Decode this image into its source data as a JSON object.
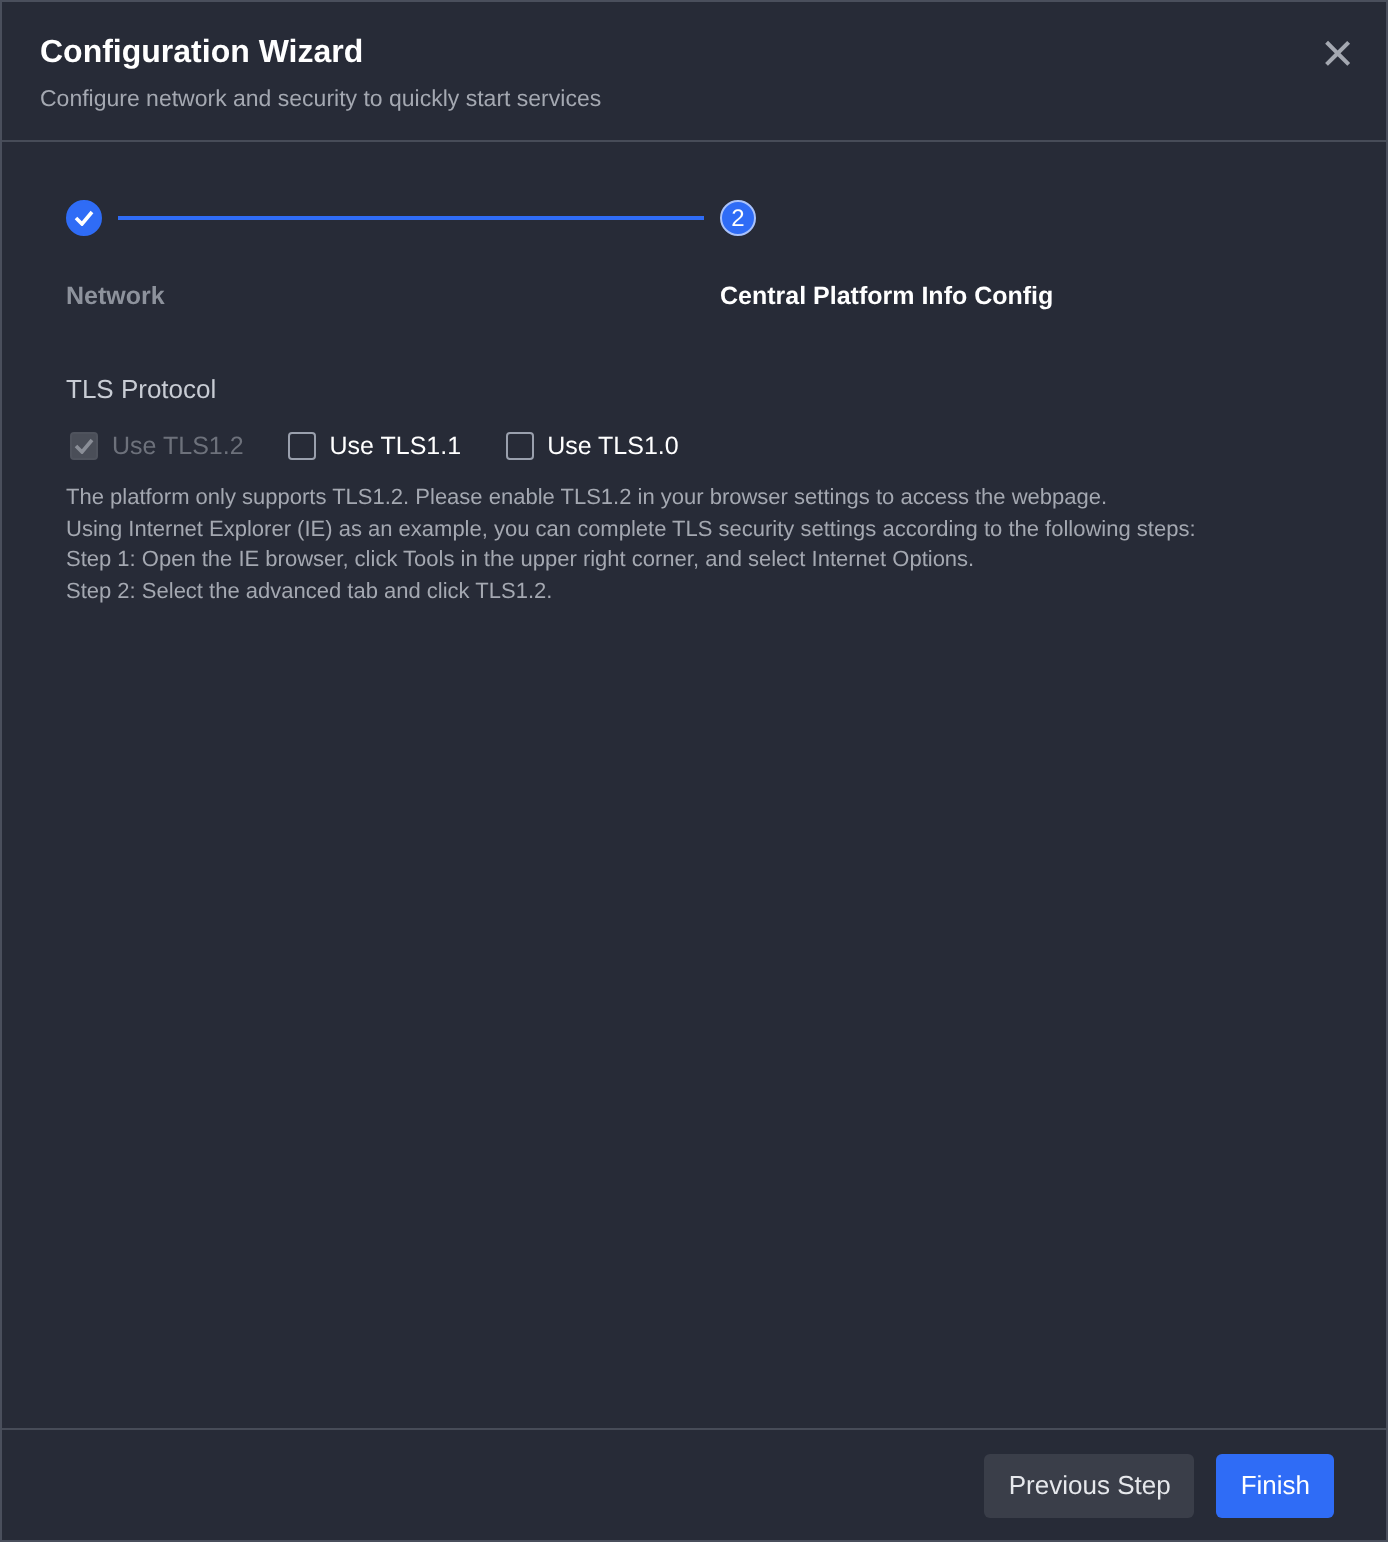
{
  "dialog": {
    "title": "Configuration Wizard",
    "subtitle": "Configure network and security to quickly start services",
    "close": "×"
  },
  "steps": [
    {
      "label": "Network",
      "completed": true,
      "current": false
    },
    {
      "number": "2",
      "label": "Central Platform Info Config",
      "completed": false,
      "current": true
    }
  ],
  "section": {
    "title": "TLS Protocol"
  },
  "options": [
    {
      "label": "Use TLS1.2",
      "checked": true,
      "disabled": true
    },
    {
      "label": "Use TLS1.1",
      "checked": false,
      "disabled": false
    },
    {
      "label": "Use TLS1.0",
      "checked": false,
      "disabled": false
    }
  ],
  "help": [
    "The platform only supports TLS1.2. Please enable TLS1.2 in your browser settings to access the webpage.",
    "Using Internet Explorer (IE) as an example, you can complete TLS security settings according to the following steps:",
    "Step 1: Open the IE browser, click Tools in the upper right corner, and select Internet Options.",
    "Step 2: Select the advanced tab and click TLS1.2."
  ],
  "buttons": [
    {
      "label": "Previous Step",
      "kind": "secondary"
    },
    {
      "label": "Finish",
      "kind": "primary"
    }
  ]
}
